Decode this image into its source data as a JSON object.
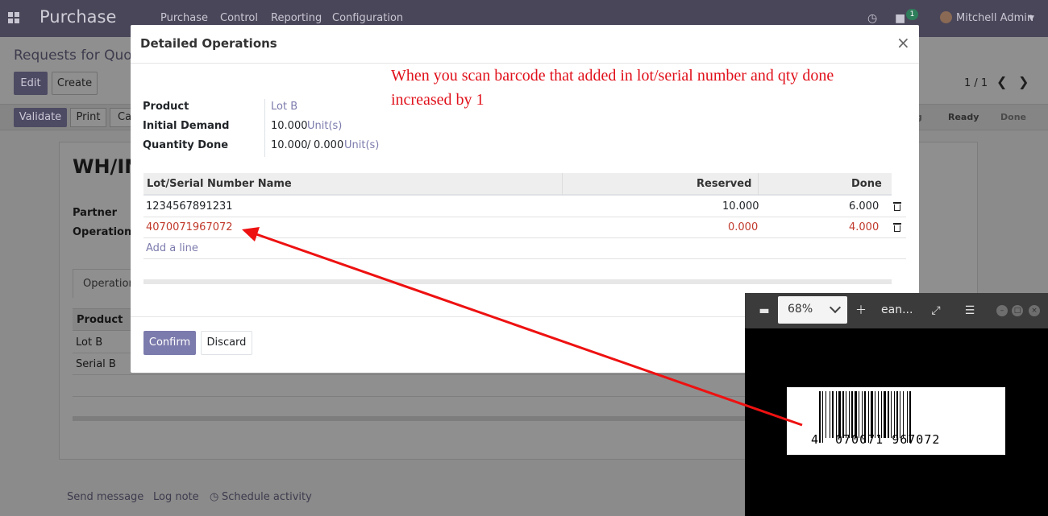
{
  "navbar": {
    "brand": "Purchase",
    "menu": [
      "Purchase",
      "Control",
      "Reporting",
      "Configuration"
    ],
    "messages_badge": "1",
    "user": "Mitchell Admin"
  },
  "control_panel": {
    "breadcrumb": "Requests for Quot",
    "edit_label": "Edit",
    "create_label": "Create",
    "pager": "1 / 1",
    "validate_label": "Validate",
    "print_label": "Print",
    "cancel_label": "Ca",
    "stages": [
      "g",
      "Ready",
      "Done"
    ]
  },
  "sheet": {
    "title": "WH/IN",
    "partner_label": "Partner",
    "operation_type_label": "Operation T",
    "tab_label": "Operations",
    "col_product": "Product",
    "rows": [
      "Lot B",
      "Serial B"
    ]
  },
  "chatter": {
    "send_message": "Send message",
    "log_note": "Log note",
    "schedule_activity": "Schedule activity"
  },
  "modal": {
    "title": "Detailed Operations",
    "close": "×",
    "annotation": "When you scan barcode that added in lot/serial number and qty done increased by 1",
    "product_label": "Product",
    "product_value": "Lot B",
    "initial_demand_label": "Initial Demand",
    "initial_demand_value": "10.000",
    "initial_demand_uom": "Unit(s)",
    "quantity_done_label": "Quantity Done",
    "quantity_done_value": "10.000",
    "quantity_done_sep": "/",
    "quantity_done_total": "0.000",
    "quantity_done_uom": "Unit(s)",
    "table": {
      "headers": [
        "Lot/Serial Number Name",
        "Reserved",
        "Done"
      ],
      "rows": [
        {
          "lot": "1234567891231",
          "reserved": "10.000",
          "done": "6.000"
        },
        {
          "lot": "4070071967072",
          "reserved": "0.000",
          "done": "4.000"
        }
      ],
      "add_line": "Add a line"
    },
    "confirm_label": "Confirm",
    "discard_label": "Discard"
  },
  "viewer": {
    "zoom": "68%",
    "title": "ean...",
    "barcode_first_digit": "4",
    "barcode_digits": "070071 967072"
  },
  "colors": {
    "annotation": "#e0101a",
    "highlight_row": "#c0392b",
    "primary": "#7c7bad",
    "arrow": "#ee1111"
  }
}
